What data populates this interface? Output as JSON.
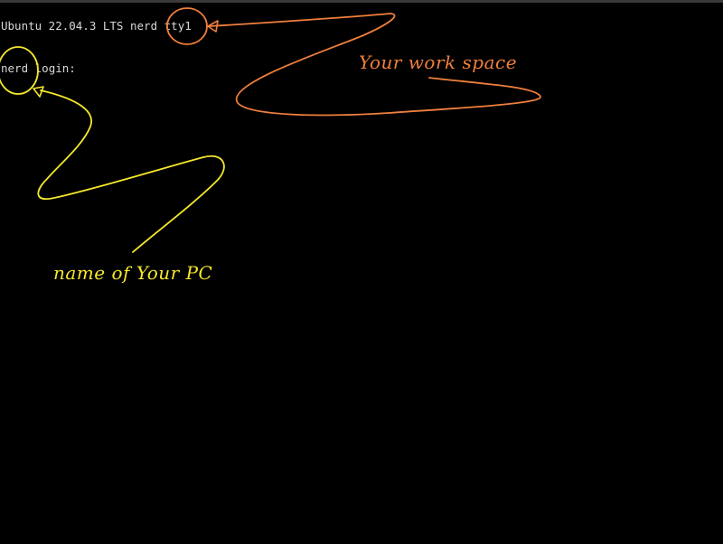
{
  "console": {
    "banner_os": "Ubuntu 22.04.3 LTS",
    "banner_hostname": "nerd",
    "banner_tty": "tty1",
    "login_hostname": "nerd",
    "login_prompt": "login:",
    "text_color": "#d8d8d8",
    "background_color": "#000000"
  },
  "annotations": {
    "workspace_note": "Your work space",
    "workspace_color": "#f07f3c",
    "pcname_note": "name of Your PC",
    "pcname_color": "#f5e82a",
    "workspace_shape": "circle-and-arrow",
    "pcname_shape": "circle-and-arrow"
  }
}
